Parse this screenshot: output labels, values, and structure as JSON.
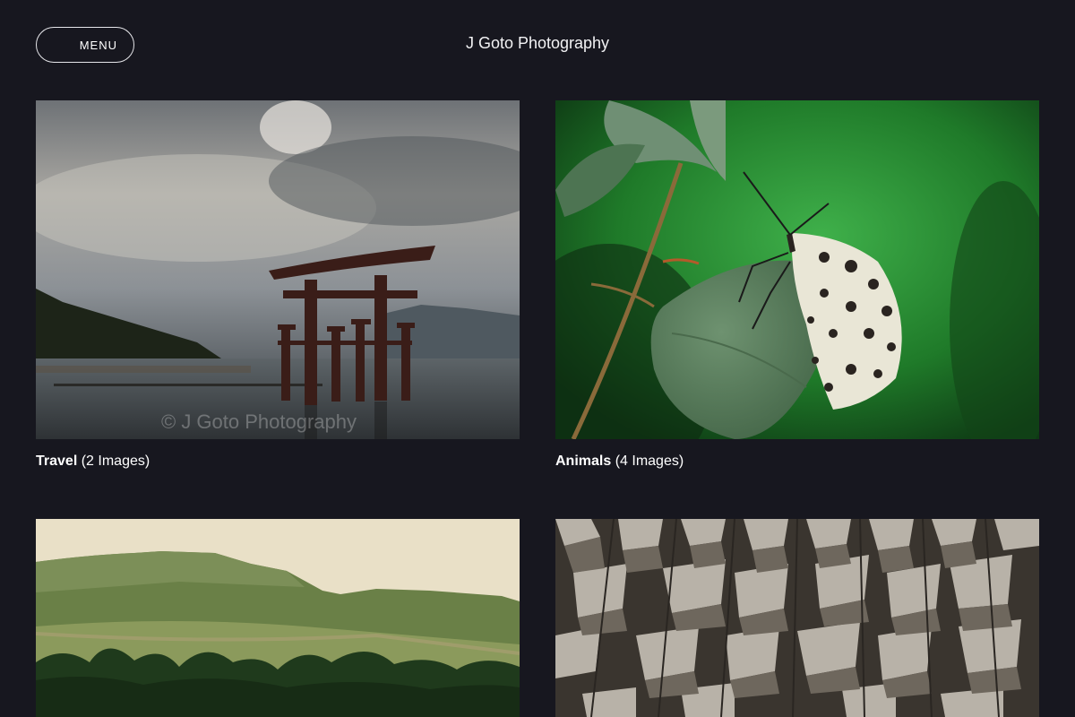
{
  "header": {
    "menu_label": "MENU",
    "site_title": "J Goto Photography"
  },
  "galleries": [
    {
      "category": "Travel",
      "count": "(2 Images)",
      "image": "torii-gate-sea"
    },
    {
      "category": "Animals",
      "count": "(4 Images)",
      "image": "butterfly-on-leaf"
    },
    {
      "category": "",
      "count": "",
      "image": "green-hills-landscape"
    },
    {
      "category": "",
      "count": "",
      "image": "geometric-facade"
    }
  ],
  "watermark_text": "© J Goto Photography"
}
